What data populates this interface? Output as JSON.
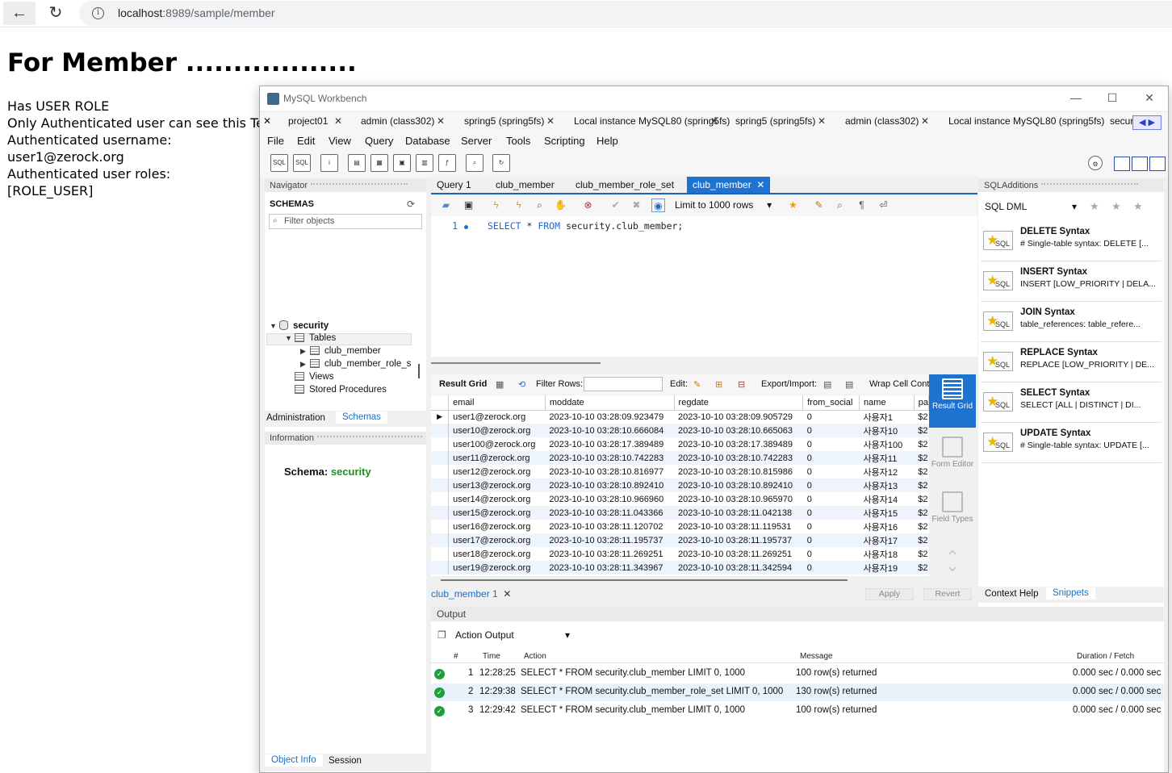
{
  "browser": {
    "url_host": "localhost",
    "url_path": ":8989/sample/member"
  },
  "page": {
    "title": "For Member ..................",
    "lines": [
      "Has USER ROLE",
      "Only Authenticated user can see this Text",
      "Authenticated username:",
      "user1@zerock.org",
      "Authenticated user roles:",
      "[ROLE_USER]"
    ]
  },
  "workbench": {
    "title": "MySQL Workbench",
    "conn_tabs": [
      "project01",
      "admin (class302)",
      "spring5 (spring5fs)",
      "Local instance MySQL80 (spring5fs)",
      "spring5 (spring5fs)",
      "admin (class302)",
      "Local instance MySQL80 (spring5fs)",
      "securi"
    ],
    "menu": [
      "File",
      "Edit",
      "View",
      "Query",
      "Database",
      "Server",
      "Tools",
      "Scripting",
      "Help"
    ],
    "navigator": {
      "header": "Navigator",
      "schemas_label": "SCHEMAS",
      "filter_placeholder": "Filter objects",
      "tree": {
        "schema": "security",
        "tables": "Tables",
        "table1": "club_member",
        "table2": "club_member_role_s",
        "views": "Views",
        "procs": "Stored Procedures"
      },
      "tabs": [
        "Administration",
        "Schemas"
      ],
      "info_header": "Information",
      "info_schema_label": "Schema:",
      "info_schema_value": "security",
      "bottom_tabs": [
        "Object Info",
        "Session"
      ]
    },
    "editor": {
      "tabs": [
        "Query 1",
        "club_member",
        "club_member_role_set",
        "club_member"
      ],
      "limit": "Limit to 1000 rows",
      "line_no": "1",
      "sql_kw1": "SELECT",
      "sql_mid": " * ",
      "sql_kw2": "FROM",
      "sql_rest": " security.club_member;"
    },
    "results": {
      "toolbar": {
        "result_grid": "Result Grid",
        "filter_rows": "Filter Rows:",
        "edit": "Edit:",
        "export": "Export/Import:",
        "wrap": "Wrap Cell Conte"
      },
      "columns": [
        "email",
        "moddate",
        "regdate",
        "from_social",
        "name",
        "pa"
      ],
      "rows": [
        [
          "user1@zerock.org",
          "2023-10-10 03:28:09.923479",
          "2023-10-10 03:28:09.905729",
          "0",
          "사용자1",
          "$2"
        ],
        [
          "user10@zerock.org",
          "2023-10-10 03:28:10.666084",
          "2023-10-10 03:28:10.665063",
          "0",
          "사용자10",
          "$2"
        ],
        [
          "user100@zerock.org",
          "2023-10-10 03:28:17.389489",
          "2023-10-10 03:28:17.389489",
          "0",
          "사용자100",
          "$2"
        ],
        [
          "user11@zerock.org",
          "2023-10-10 03:28:10.742283",
          "2023-10-10 03:28:10.742283",
          "0",
          "사용자11",
          "$2"
        ],
        [
          "user12@zerock.org",
          "2023-10-10 03:28:10.816977",
          "2023-10-10 03:28:10.815986",
          "0",
          "사용자12",
          "$2"
        ],
        [
          "user13@zerock.org",
          "2023-10-10 03:28:10.892410",
          "2023-10-10 03:28:10.892410",
          "0",
          "사용자13",
          "$2"
        ],
        [
          "user14@zerock.org",
          "2023-10-10 03:28:10.966960",
          "2023-10-10 03:28:10.965970",
          "0",
          "사용자14",
          "$2"
        ],
        [
          "user15@zerock.org",
          "2023-10-10 03:28:11.043366",
          "2023-10-10 03:28:11.042138",
          "0",
          "사용자15",
          "$2"
        ],
        [
          "user16@zerock.org",
          "2023-10-10 03:28:11.120702",
          "2023-10-10 03:28:11.119531",
          "0",
          "사용자16",
          "$2"
        ],
        [
          "user17@zerock.org",
          "2023-10-10 03:28:11.195737",
          "2023-10-10 03:28:11.195737",
          "0",
          "사용자17",
          "$2"
        ],
        [
          "user18@zerock.org",
          "2023-10-10 03:28:11.269251",
          "2023-10-10 03:28:11.269251",
          "0",
          "사용자18",
          "$2"
        ],
        [
          "user19@zerock.org",
          "2023-10-10 03:28:11.343967",
          "2023-10-10 03:28:11.342594",
          "0",
          "사용자19",
          "$2"
        ]
      ],
      "side": [
        "Result Grid",
        "Form Editor",
        "Field Types"
      ],
      "result_tab": "club_member 1",
      "apply": "Apply",
      "revert": "Revert"
    },
    "sql_additions": {
      "header": "SQLAdditions",
      "select": "SQL DML",
      "icon_text": "SQL",
      "snippets": [
        {
          "title": "DELETE Syntax",
          "desc": "# Single-table syntax: DELETE [..."
        },
        {
          "title": "INSERT Syntax",
          "desc": "INSERT [LOW_PRIORITY | DELA..."
        },
        {
          "title": "JOIN Syntax",
          "desc": "table_references:     table_refere..."
        },
        {
          "title": "REPLACE Syntax",
          "desc": "REPLACE [LOW_PRIORITY | DE..."
        },
        {
          "title": "SELECT Syntax",
          "desc": "SELECT     [ALL | DISTINCT | DI..."
        },
        {
          "title": "UPDATE Syntax",
          "desc": "# Single-table syntax: UPDATE [..."
        }
      ],
      "tabs": [
        "Context Help",
        "Snippets"
      ]
    },
    "output": {
      "header": "Output",
      "select": "Action Output",
      "columns": [
        "#",
        "Time",
        "Action",
        "Message",
        "Duration / Fetch"
      ],
      "rows": [
        [
          "1",
          "12:28:25",
          "SELECT * FROM security.club_member LIMIT 0, 1000",
          "100 row(s) returned",
          "0.000 sec / 0.000 sec"
        ],
        [
          "2",
          "12:29:38",
          "SELECT * FROM security.club_member_role_set LIMIT 0, 1000",
          "130 row(s) returned",
          "0.000 sec / 0.000 sec"
        ],
        [
          "3",
          "12:29:42",
          "SELECT * FROM security.club_member LIMIT 0, 1000",
          "100 row(s) returned",
          "0.000 sec / 0.000 sec"
        ]
      ]
    }
  }
}
